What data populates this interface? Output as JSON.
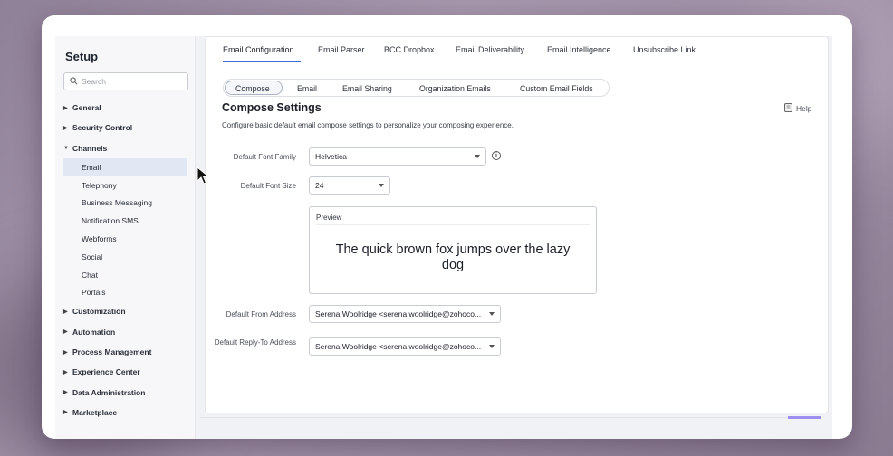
{
  "sidebar": {
    "title": "Setup",
    "search_placeholder": "Search",
    "items": [
      {
        "label": "General",
        "type": "group",
        "expanded": false
      },
      {
        "label": "Security Control",
        "type": "group",
        "expanded": false
      },
      {
        "label": "Channels",
        "type": "group",
        "expanded": true
      },
      {
        "label": "Email",
        "type": "sub",
        "active": true
      },
      {
        "label": "Telephony",
        "type": "sub"
      },
      {
        "label": "Business Messaging",
        "type": "sub"
      },
      {
        "label": "Notification SMS",
        "type": "sub"
      },
      {
        "label": "Webforms",
        "type": "sub"
      },
      {
        "label": "Social",
        "type": "sub"
      },
      {
        "label": "Chat",
        "type": "sub"
      },
      {
        "label": "Portals",
        "type": "sub"
      },
      {
        "label": "Customization",
        "type": "group",
        "expanded": false
      },
      {
        "label": "Automation",
        "type": "group",
        "expanded": false
      },
      {
        "label": "Process Management",
        "type": "group",
        "expanded": false
      },
      {
        "label": "Experience Center",
        "type": "group",
        "expanded": false
      },
      {
        "label": "Data Administration",
        "type": "group",
        "expanded": false
      },
      {
        "label": "Marketplace",
        "type": "group",
        "expanded": false
      }
    ]
  },
  "tabs": [
    {
      "label": "Email Configuration",
      "active": true
    },
    {
      "label": "Email Parser"
    },
    {
      "label": "BCC Dropbox"
    },
    {
      "label": "Email Deliverability"
    },
    {
      "label": "Email Intelligence"
    },
    {
      "label": "Unsubscribe Link"
    }
  ],
  "subtabs": [
    {
      "label": "Compose",
      "active": true
    },
    {
      "label": "Email"
    },
    {
      "label": "Email Sharing"
    },
    {
      "label": "Organization Emails"
    },
    {
      "label": "Custom Email Fields"
    }
  ],
  "compose": {
    "title": "Compose Settings",
    "description": "Configure basic default email compose settings to personalize your composing experience.",
    "help_label": "Help",
    "font_family_label": "Default Font Family",
    "font_family_value": "Helvetica",
    "font_size_label": "Default Font Size",
    "font_size_value": "24",
    "preview_label": "Preview",
    "preview_text": "The quick brown fox jumps over the lazy dog",
    "from_address_label": "Default From Address",
    "from_address_value": "Serena Woolridge <serena.woolridge@zohoco...",
    "reply_to_label": "Default Reply-To Address",
    "reply_to_value": "Serena Woolridge <serena.woolridge@zohoco..."
  },
  "colors": {
    "accent": "#3b6ad6",
    "active_sidebar_bg": "#e2e8f3"
  }
}
